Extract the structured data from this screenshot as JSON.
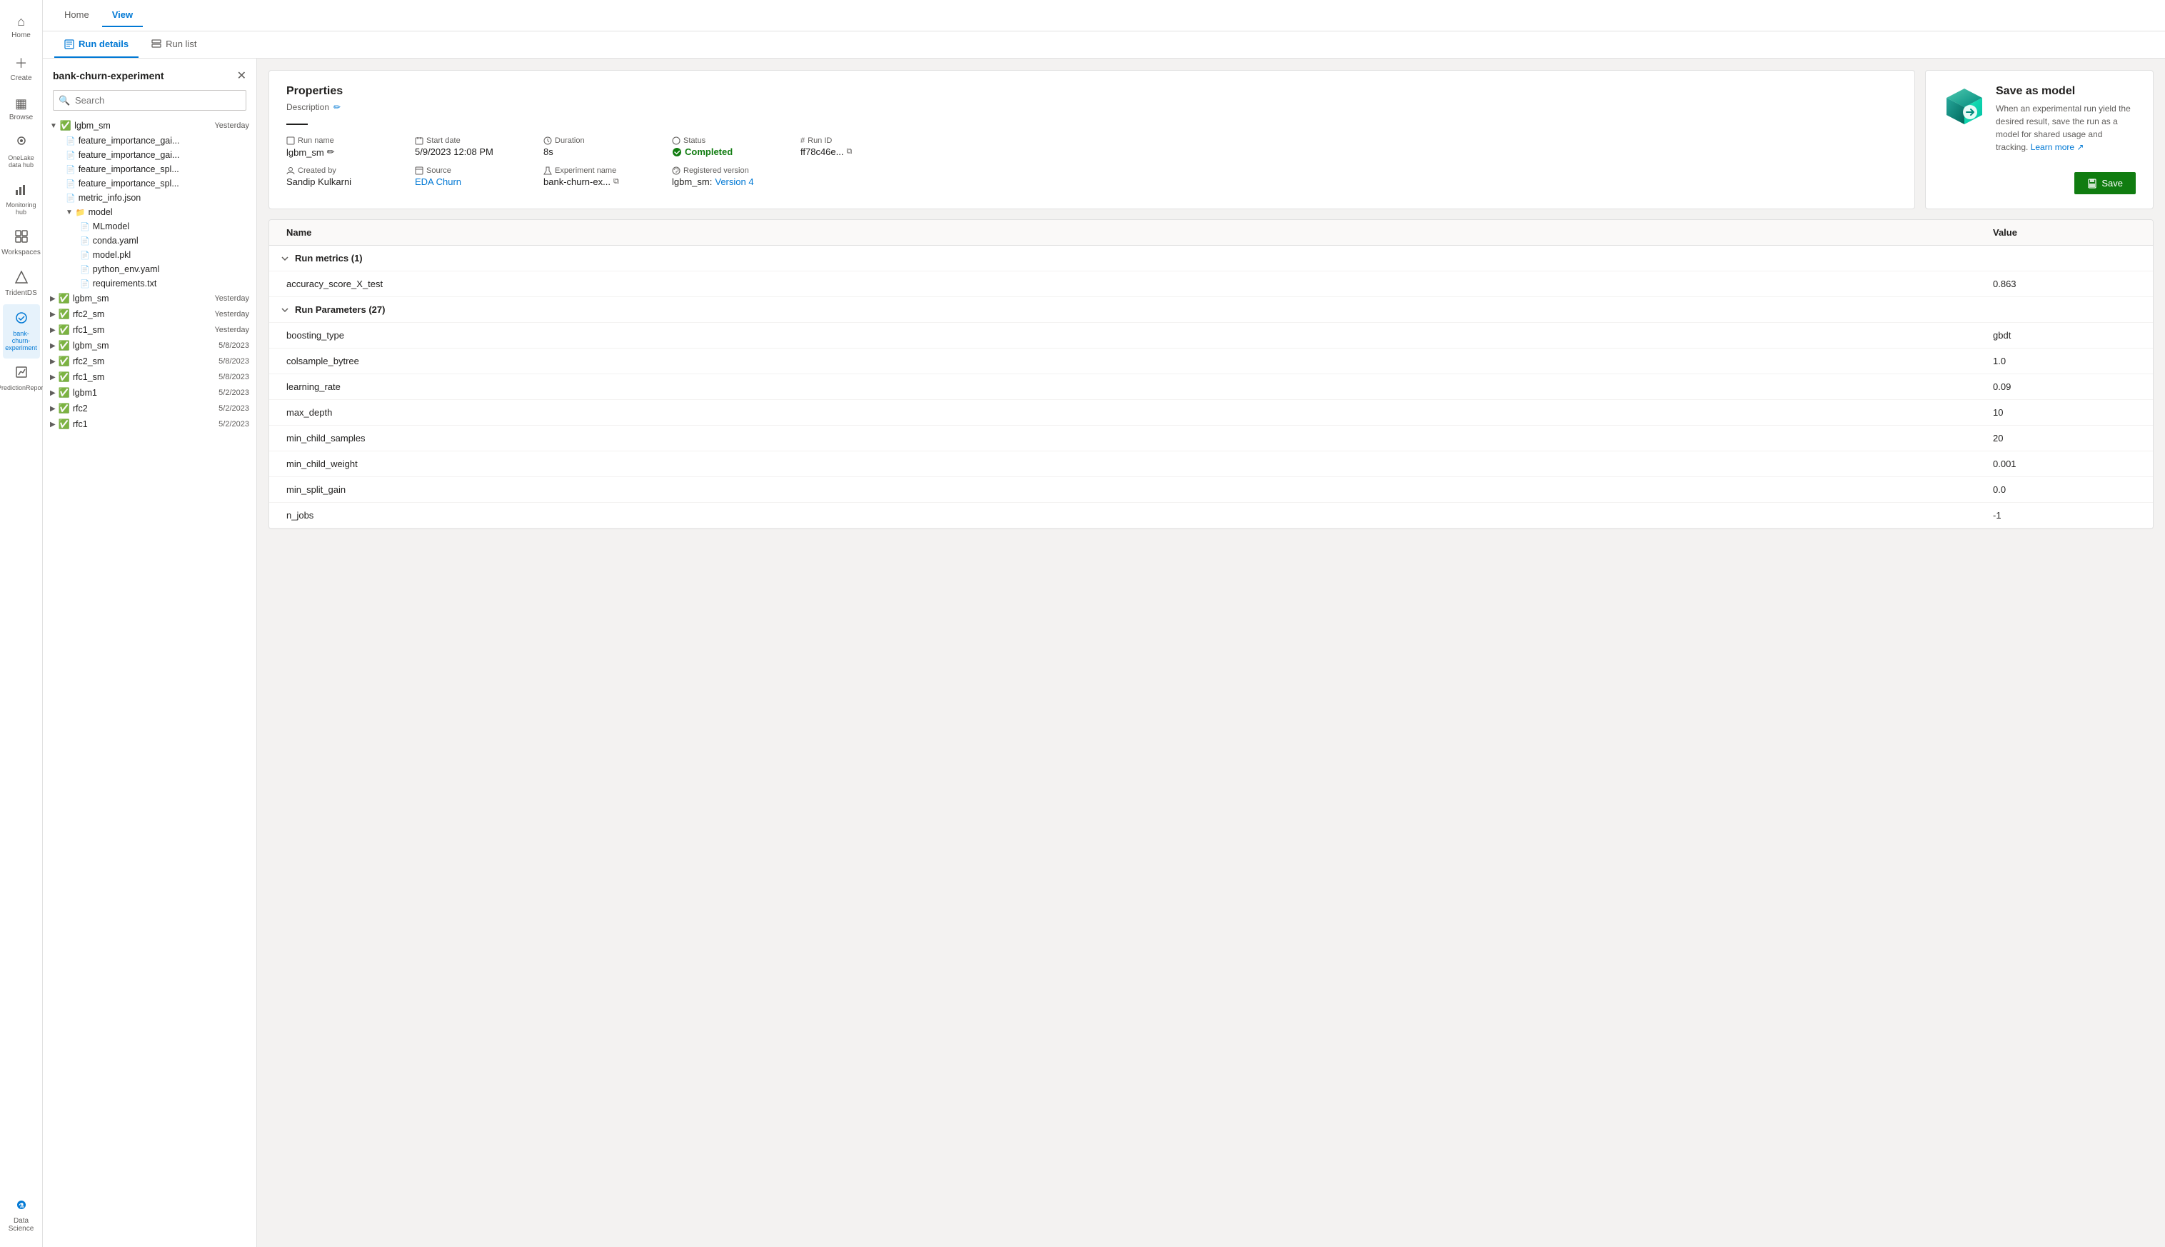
{
  "nav": {
    "items": [
      {
        "id": "home",
        "label": "Home",
        "icon": "⌂"
      },
      {
        "id": "create",
        "label": "Create",
        "icon": "+"
      },
      {
        "id": "browse",
        "label": "Browse",
        "icon": "▦"
      },
      {
        "id": "onelake",
        "label": "OneLake data hub",
        "icon": "○"
      },
      {
        "id": "monitoring",
        "label": "Monitoring hub",
        "icon": "📊"
      },
      {
        "id": "workspaces",
        "label": "Workspaces",
        "icon": "⊞"
      },
      {
        "id": "tridentds",
        "label": "TridentDS",
        "icon": "🔷"
      },
      {
        "id": "bank-churn",
        "label": "bank-churn-experiment",
        "icon": "🧪",
        "active": true
      },
      {
        "id": "prediction",
        "label": "PredictionReport",
        "icon": "📈"
      },
      {
        "id": "datascience",
        "label": "Data Science",
        "icon": "🔬"
      }
    ]
  },
  "topbar": {
    "tabs": [
      {
        "id": "home",
        "label": "Home",
        "active": false
      },
      {
        "id": "view",
        "label": "View",
        "active": true
      }
    ]
  },
  "view_tabs": [
    {
      "id": "run-details",
      "label": "Run details",
      "active": true
    },
    {
      "id": "run-list",
      "label": "Run list",
      "active": false
    }
  ],
  "sidebar": {
    "title": "bank-churn-experiment",
    "search_placeholder": "Search",
    "tree": [
      {
        "id": "lgbm_sm_1",
        "level": 0,
        "type": "run",
        "expanded": true,
        "status": "completed",
        "label": "lgbm_sm",
        "date": "Yesterday"
      },
      {
        "id": "feat1",
        "level": 2,
        "type": "file",
        "label": "feature_importance_gai...",
        "date": ""
      },
      {
        "id": "feat2",
        "level": 2,
        "type": "file",
        "label": "feature_importance_gai...",
        "date": ""
      },
      {
        "id": "feat3",
        "level": 2,
        "type": "file",
        "label": "feature_importance_spl...",
        "date": ""
      },
      {
        "id": "feat4",
        "level": 2,
        "type": "file",
        "label": "feature_importance_spl...",
        "date": ""
      },
      {
        "id": "metric",
        "level": 2,
        "type": "file",
        "label": "metric_info.json",
        "date": ""
      },
      {
        "id": "model_folder",
        "level": 2,
        "type": "folder",
        "expanded": true,
        "label": "model",
        "date": ""
      },
      {
        "id": "mlmodel",
        "level": 3,
        "type": "file",
        "label": "MLmodel",
        "date": ""
      },
      {
        "id": "conda",
        "level": 3,
        "type": "file",
        "label": "conda.yaml",
        "date": ""
      },
      {
        "id": "modelpkl",
        "level": 3,
        "type": "file",
        "label": "model.pkl",
        "date": ""
      },
      {
        "id": "python_env",
        "level": 3,
        "type": "file",
        "label": "python_env.yaml",
        "date": ""
      },
      {
        "id": "requirements",
        "level": 3,
        "type": "file",
        "label": "requirements.txt",
        "date": ""
      },
      {
        "id": "lgbm_sm_2",
        "level": 0,
        "type": "run",
        "expanded": false,
        "status": "completed",
        "label": "lgbm_sm",
        "date": "Yesterday"
      },
      {
        "id": "rfc2_sm_1",
        "level": 0,
        "type": "run",
        "expanded": false,
        "status": "completed",
        "label": "rfc2_sm",
        "date": "Yesterday"
      },
      {
        "id": "rfc1_sm_1",
        "level": 0,
        "type": "run",
        "expanded": false,
        "status": "completed",
        "label": "rfc1_sm",
        "date": "Yesterday"
      },
      {
        "id": "lgbm_sm_3",
        "level": 0,
        "type": "run",
        "expanded": false,
        "status": "completed",
        "label": "lgbm_sm",
        "date": "5/8/2023"
      },
      {
        "id": "rfc2_sm_2",
        "level": 0,
        "type": "run",
        "expanded": false,
        "status": "completed",
        "label": "rfc2_sm",
        "date": "5/8/2023"
      },
      {
        "id": "rfc1_sm_2",
        "level": 0,
        "type": "run",
        "expanded": false,
        "status": "completed",
        "label": "rfc1_sm",
        "date": "5/8/2023"
      },
      {
        "id": "lgbm1",
        "level": 0,
        "type": "run",
        "expanded": false,
        "status": "completed",
        "label": "lgbm1",
        "date": "5/2/2023"
      },
      {
        "id": "rfc2_1",
        "level": 0,
        "type": "run",
        "expanded": false,
        "status": "completed",
        "label": "rfc2",
        "date": "5/2/2023"
      },
      {
        "id": "rfc1_1",
        "level": 0,
        "type": "run",
        "expanded": false,
        "status": "completed",
        "label": "rfc1",
        "date": "5/2/2023"
      }
    ]
  },
  "properties": {
    "title": "Properties",
    "description_label": "Description",
    "edit_icon": "✏",
    "run_name_label": "Run name",
    "run_name_value": "lgbm_sm",
    "start_date_label": "Start date",
    "start_date_value": "5/9/2023 12:08 PM",
    "duration_label": "Duration",
    "duration_value": "8s",
    "status_label": "Status",
    "status_value": "Completed",
    "run_id_label": "Run ID",
    "run_id_value": "ff78c46e...",
    "created_by_label": "Created by",
    "created_by_value": "Sandip Kulkarni",
    "source_label": "Source",
    "source_value": "EDA Churn",
    "experiment_name_label": "Experiment name",
    "experiment_name_value": "bank-churn-ex...",
    "registered_version_label": "Registered version",
    "registered_version_value": "lgbm_sm: Version 4"
  },
  "save_as_model": {
    "title": "Save as model",
    "description": "When an experimental run yield the desired result, save the run as a model for shared usage and tracking.",
    "learn_more_text": "Learn more",
    "save_button_label": "Save"
  },
  "metrics_table": {
    "col_name": "Name",
    "col_value": "Value",
    "sections": [
      {
        "id": "run-metrics",
        "title": "Run metrics (1)",
        "expanded": true,
        "rows": [
          {
            "name": "accuracy_score_X_test",
            "value": "0.863"
          }
        ]
      },
      {
        "id": "run-parameters",
        "title": "Run Parameters (27)",
        "expanded": true,
        "rows": [
          {
            "name": "boosting_type",
            "value": "gbdt"
          },
          {
            "name": "colsample_bytree",
            "value": "1.0"
          },
          {
            "name": "learning_rate",
            "value": "0.09"
          },
          {
            "name": "max_depth",
            "value": "10"
          },
          {
            "name": "min_child_samples",
            "value": "20"
          },
          {
            "name": "min_child_weight",
            "value": "0.001"
          },
          {
            "name": "min_split_gain",
            "value": "0.0"
          },
          {
            "name": "n_jobs",
            "value": "-1"
          }
        ]
      }
    ]
  }
}
